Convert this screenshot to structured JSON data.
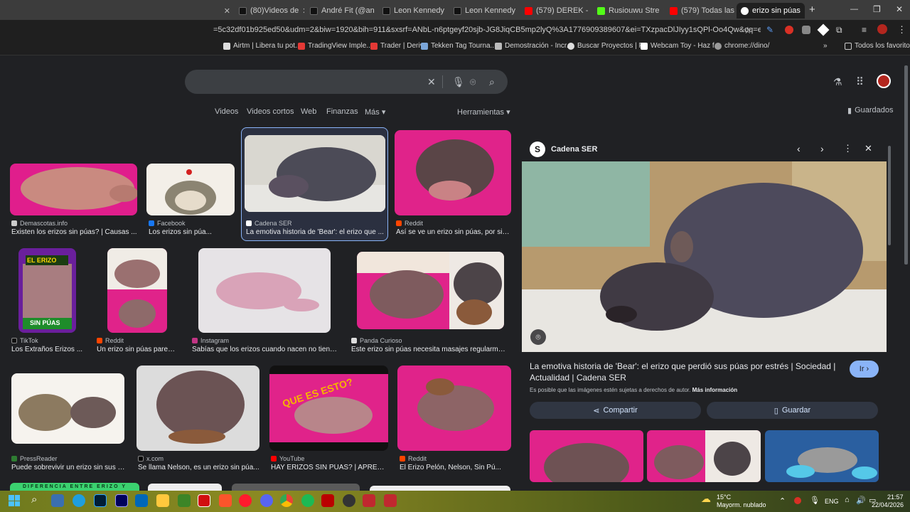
{
  "tabs": [
    {
      "label": "(80)Videos de"
    },
    {
      "label": "André Fit (@an"
    },
    {
      "label": "Leon Kennedy"
    },
    {
      "label": "Leon Kennedy"
    },
    {
      "label": "(579) DEREK -"
    },
    {
      "label": "Rusiouwu Stre"
    },
    {
      "label": "(579) Todas las"
    },
    {
      "label": "erizo sin púas"
    }
  ],
  "new_tab": "+",
  "url": "=5c32df01b925ed50&udm=2&biw=1920&bih=911&sxsrf=ANbL-n6ptgeyf20sjb-JG8JiqCB5mp2lyQ%3A1776909389607&ei=TXzpacDlJIyy1sQPl-Oo4Qw&oq=erizo+sin+&gs_lp=...",
  "bookmarks": [
    {
      "label": "Airtm | Libera tu pot..."
    },
    {
      "label": "TradingView Imple..."
    },
    {
      "label": "Trader | Deriv"
    },
    {
      "label": "Tekken Tag Tourna..."
    },
    {
      "label": "Demostración - Incr..."
    },
    {
      "label": "Buscar Proyectos | F..."
    },
    {
      "label": "Webcam Toy - Haz f..."
    },
    {
      "label": "chrome://dino/"
    }
  ],
  "all_bookmarks": "Todos los favoritos",
  "nav_tabs": [
    "Videos",
    "Videos cortos",
    "Web",
    "Finanzas",
    "Más ▾"
  ],
  "tools": "Herramientas ▾",
  "saved": "Guardados",
  "results": [
    {
      "source": "Demascotas.info",
      "caption": "Existen los erizos sin púas? | Causas ..."
    },
    {
      "source": "Facebook",
      "caption": "Los erizos sin púa..."
    },
    {
      "source": "Cadena SER",
      "caption": "La emotiva historia de 'Bear': el erizo que ..."
    },
    {
      "source": "Reddit",
      "caption": "Así se ve un erizo sin púas, por si ..."
    },
    {
      "source": "TikTok",
      "caption": "Los Extraños Erizos ..."
    },
    {
      "source": "Reddit",
      "caption": "Un erizo sin púas parec..."
    },
    {
      "source": "Instagram",
      "caption": "Sabías que los erizos cuando nacen no tiene..."
    },
    {
      "source": "Panda Curioso",
      "caption": "Este erizo sin púas necesita masajes regularment..."
    },
    {
      "source": "PressReader",
      "caption": "Puede sobrevivir un erizo sin sus p..."
    },
    {
      "source": "x.com",
      "caption": "Se llama Nelson, es un erizo sin púa..."
    },
    {
      "source": "YouTube",
      "caption": "HAY ERIZOS SIN PÚAS? | APREN..."
    },
    {
      "source": "Reddit",
      "caption": "El Erizo Pelón, Nelson, Sin Pú..."
    }
  ],
  "tiktok_overlay": {
    "top": "EL ERIZO",
    "bottom": "SIN PÚAS"
  },
  "youtube_overlay": "QUE ES ESTO?",
  "bottom_banner": "DIFERENCIA ENTRE ERIZO Y",
  "panel": {
    "source": "Cadena SER",
    "title": "La emotiva historia de 'Bear': el erizo que perdió sus púas por estrés | Sociedad | Actualidad | Cadena SER",
    "go": "Ir ›",
    "rights": "Es posible que las imágenes estén sujetas a derechos de autor.",
    "more_info": "Más información",
    "share": "Compartir",
    "save": "Guardar"
  },
  "tray": {
    "temp": "15°C",
    "weather": "Mayorm. nublado",
    "lang": "ENG",
    "time": "21:57",
    "date": "22/04/2026"
  },
  "colors": {
    "accent": "#8ab4f8",
    "pink": "#e0238a"
  }
}
